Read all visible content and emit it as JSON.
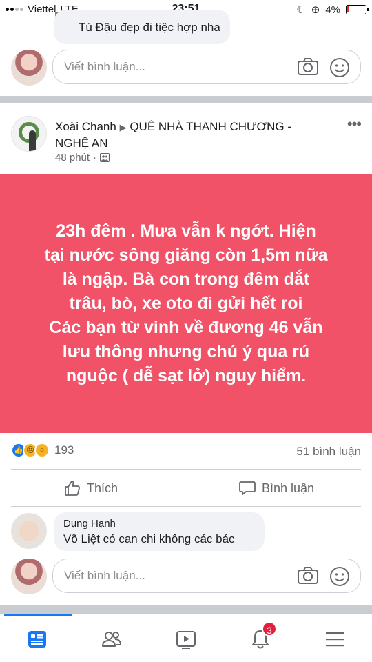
{
  "status_bar": {
    "carrier": "Viettel",
    "network": "LTE",
    "time": "23:51",
    "battery_percent": "4%",
    "battery_level": 0.04
  },
  "previous_comment": {
    "text": "Tú Đậu đẹp đi tiệc hợp nha"
  },
  "composer": {
    "placeholder": "Viết bình luận..."
  },
  "post": {
    "author": "Xoài Chanh",
    "group": "QUÊ NHÀ THANH CHƯƠNG - NGHỆ AN",
    "time_ago": "48 phút",
    "separator": "·",
    "background_color": "#f25268",
    "text_lines": [
      "23h đêm . Mưa vẫn k ngớt. Hiện",
      "tại nước sông giăng còn 1,5m nữa",
      "là ngập. Bà con trong đêm dắt",
      "trâu, bò, xe oto đi gửi hết roi",
      "Các bạn từ vinh về đương 46 vẫn",
      "lưu thông nhưng chú ý qua rú",
      "nguộc ( dễ sạt lở) nguy hiểm."
    ]
  },
  "engagement": {
    "reactions": [
      "like",
      "sad",
      "wow"
    ],
    "reaction_count": "193",
    "comment_count": "51 bình luận"
  },
  "actions": {
    "like_label": "Thích",
    "comment_label": "Bình luận"
  },
  "comment": {
    "name": "Dụng Hạnh",
    "text": "Võ Liệt có can chi không các bác"
  },
  "bottom_nav": {
    "items": [
      "news-feed",
      "friends",
      "watch",
      "notifications",
      "menu"
    ],
    "notification_badge": "3",
    "accent_color": "#1877f2"
  }
}
